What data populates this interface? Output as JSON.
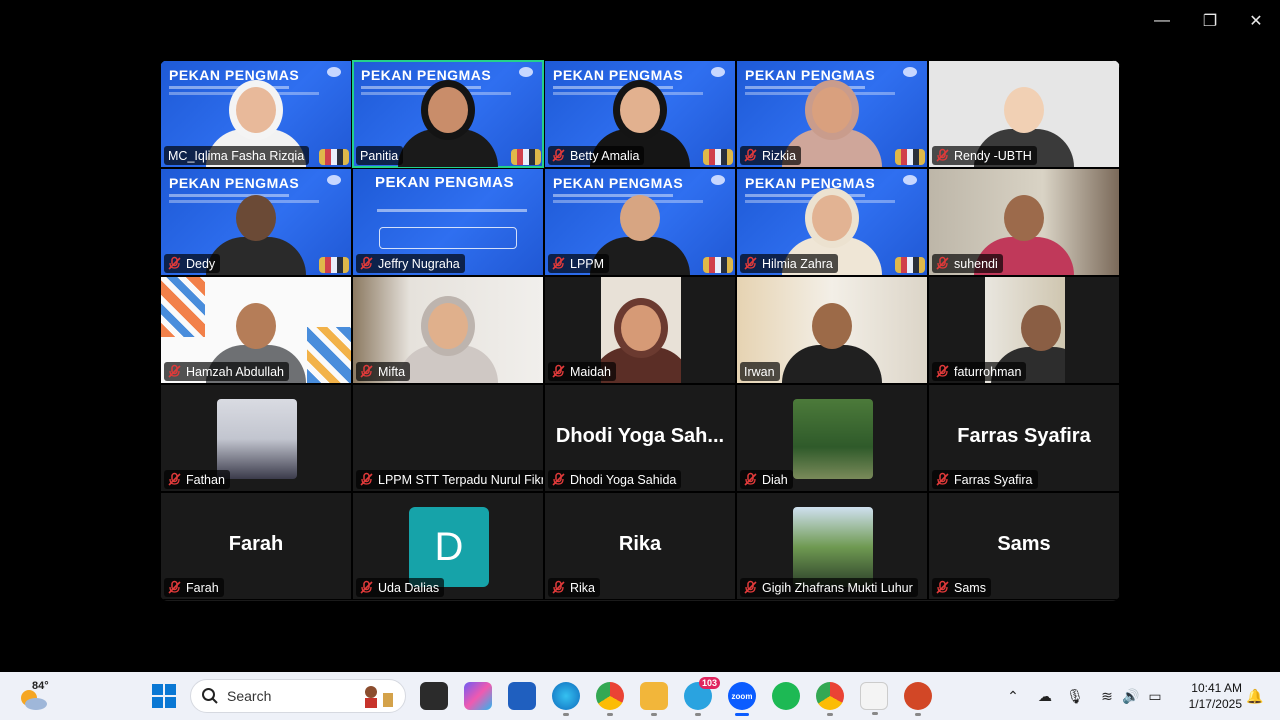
{
  "window": {
    "minimize": "—",
    "restore": "❐",
    "close": "✕"
  },
  "event": {
    "title": "PEKAN PENGMAS"
  },
  "tiles": [
    {
      "name": "MC_Iqlima Fasha Rizqia",
      "muted": false,
      "bg": "event",
      "skin": "#e8b99a",
      "cloth": "#f2f2f2"
    },
    {
      "name": "Panitia",
      "muted": false,
      "bg": "event",
      "skin": "#c98d6a",
      "cloth": "#1a1a1a",
      "active": true
    },
    {
      "name": "Betty Amalia",
      "muted": true,
      "bg": "event",
      "skin": "#e2b18f",
      "cloth": "#151515"
    },
    {
      "name": "Rizkia",
      "muted": true,
      "bg": "event",
      "skin": "#d9a07e",
      "cloth": "#cfa69a"
    },
    {
      "name": "Rendy -UBTH",
      "muted": true,
      "bg": "light",
      "skin": "#f1d0b4",
      "cloth": "#3a3a3a"
    },
    {
      "name": "Dedy",
      "muted": true,
      "bg": "event",
      "skin": "#6b4a36",
      "cloth": "#2a2a2a"
    },
    {
      "name": "Jeffry Nugraha",
      "muted": true,
      "bg": "poster"
    },
    {
      "name": "LPPM",
      "muted": true,
      "bg": "event",
      "skin": "#d7a582",
      "cloth": "#1c1c1c"
    },
    {
      "name": "Hilmia Zahra",
      "muted": true,
      "bg": "event",
      "skin": "#e2b393",
      "cloth": "#efe6d6"
    },
    {
      "name": "suhendi",
      "muted": true,
      "bg": "office",
      "skin": "#9c6a4b",
      "cloth": "#c0395a"
    },
    {
      "name": "Hamzah Abdullah",
      "muted": true,
      "bg": "white",
      "skin": "#b57d58",
      "cloth": "#6e7073"
    },
    {
      "name": "Mifta",
      "muted": true,
      "bg": "room",
      "skin": "#e0b08c",
      "cloth": "#cfc8c4"
    },
    {
      "name": "Maidah",
      "muted": true,
      "bg": "dark",
      "skin": "#d69a76",
      "cloth": "#5b2e26"
    },
    {
      "name": "Irwan",
      "muted": false,
      "bg": "shelf",
      "skin": "#9c6a48",
      "cloth": "#202020"
    },
    {
      "name": "faturrohman",
      "muted": true,
      "bg": "dark2",
      "skin": "#8a5e44",
      "cloth": "#2d2d2d"
    },
    {
      "name": "Fathan",
      "muted": true,
      "bg": "thumb"
    },
    {
      "name": "LPPM STT Terpadu Nurul Fikri",
      "muted": true,
      "bg": "none"
    },
    {
      "name": "Dhodi Yoga Sahida",
      "muted": true,
      "bg": "none",
      "display": "Dhodi Yoga Sah..."
    },
    {
      "name": "Diah",
      "muted": true,
      "bg": "thumb2"
    },
    {
      "name": "Farras Syafira",
      "muted": true,
      "bg": "none",
      "display": "Farras Syafira"
    },
    {
      "name": "Farah",
      "muted": true,
      "bg": "none",
      "display": "Farah"
    },
    {
      "name": "Uda Dalias",
      "muted": true,
      "bg": "avatar",
      "initial": "D"
    },
    {
      "name": "Rika",
      "muted": true,
      "bg": "none",
      "display": "Rika"
    },
    {
      "name": "Gigih Zhafrans Mukti Luhur",
      "muted": true,
      "bg": "thumb3"
    },
    {
      "name": "Sams",
      "muted": true,
      "bg": "none",
      "display": "Sams"
    }
  ],
  "taskbar": {
    "weather_temp": "84°",
    "search_label": "Search",
    "telegram_badge": "103",
    "zoom_label": "zoom",
    "time": "10:41 AM",
    "date": "1/17/2025"
  },
  "colors": {
    "active_speaker": "#23d18b",
    "mute_red": "#e03a3a"
  }
}
